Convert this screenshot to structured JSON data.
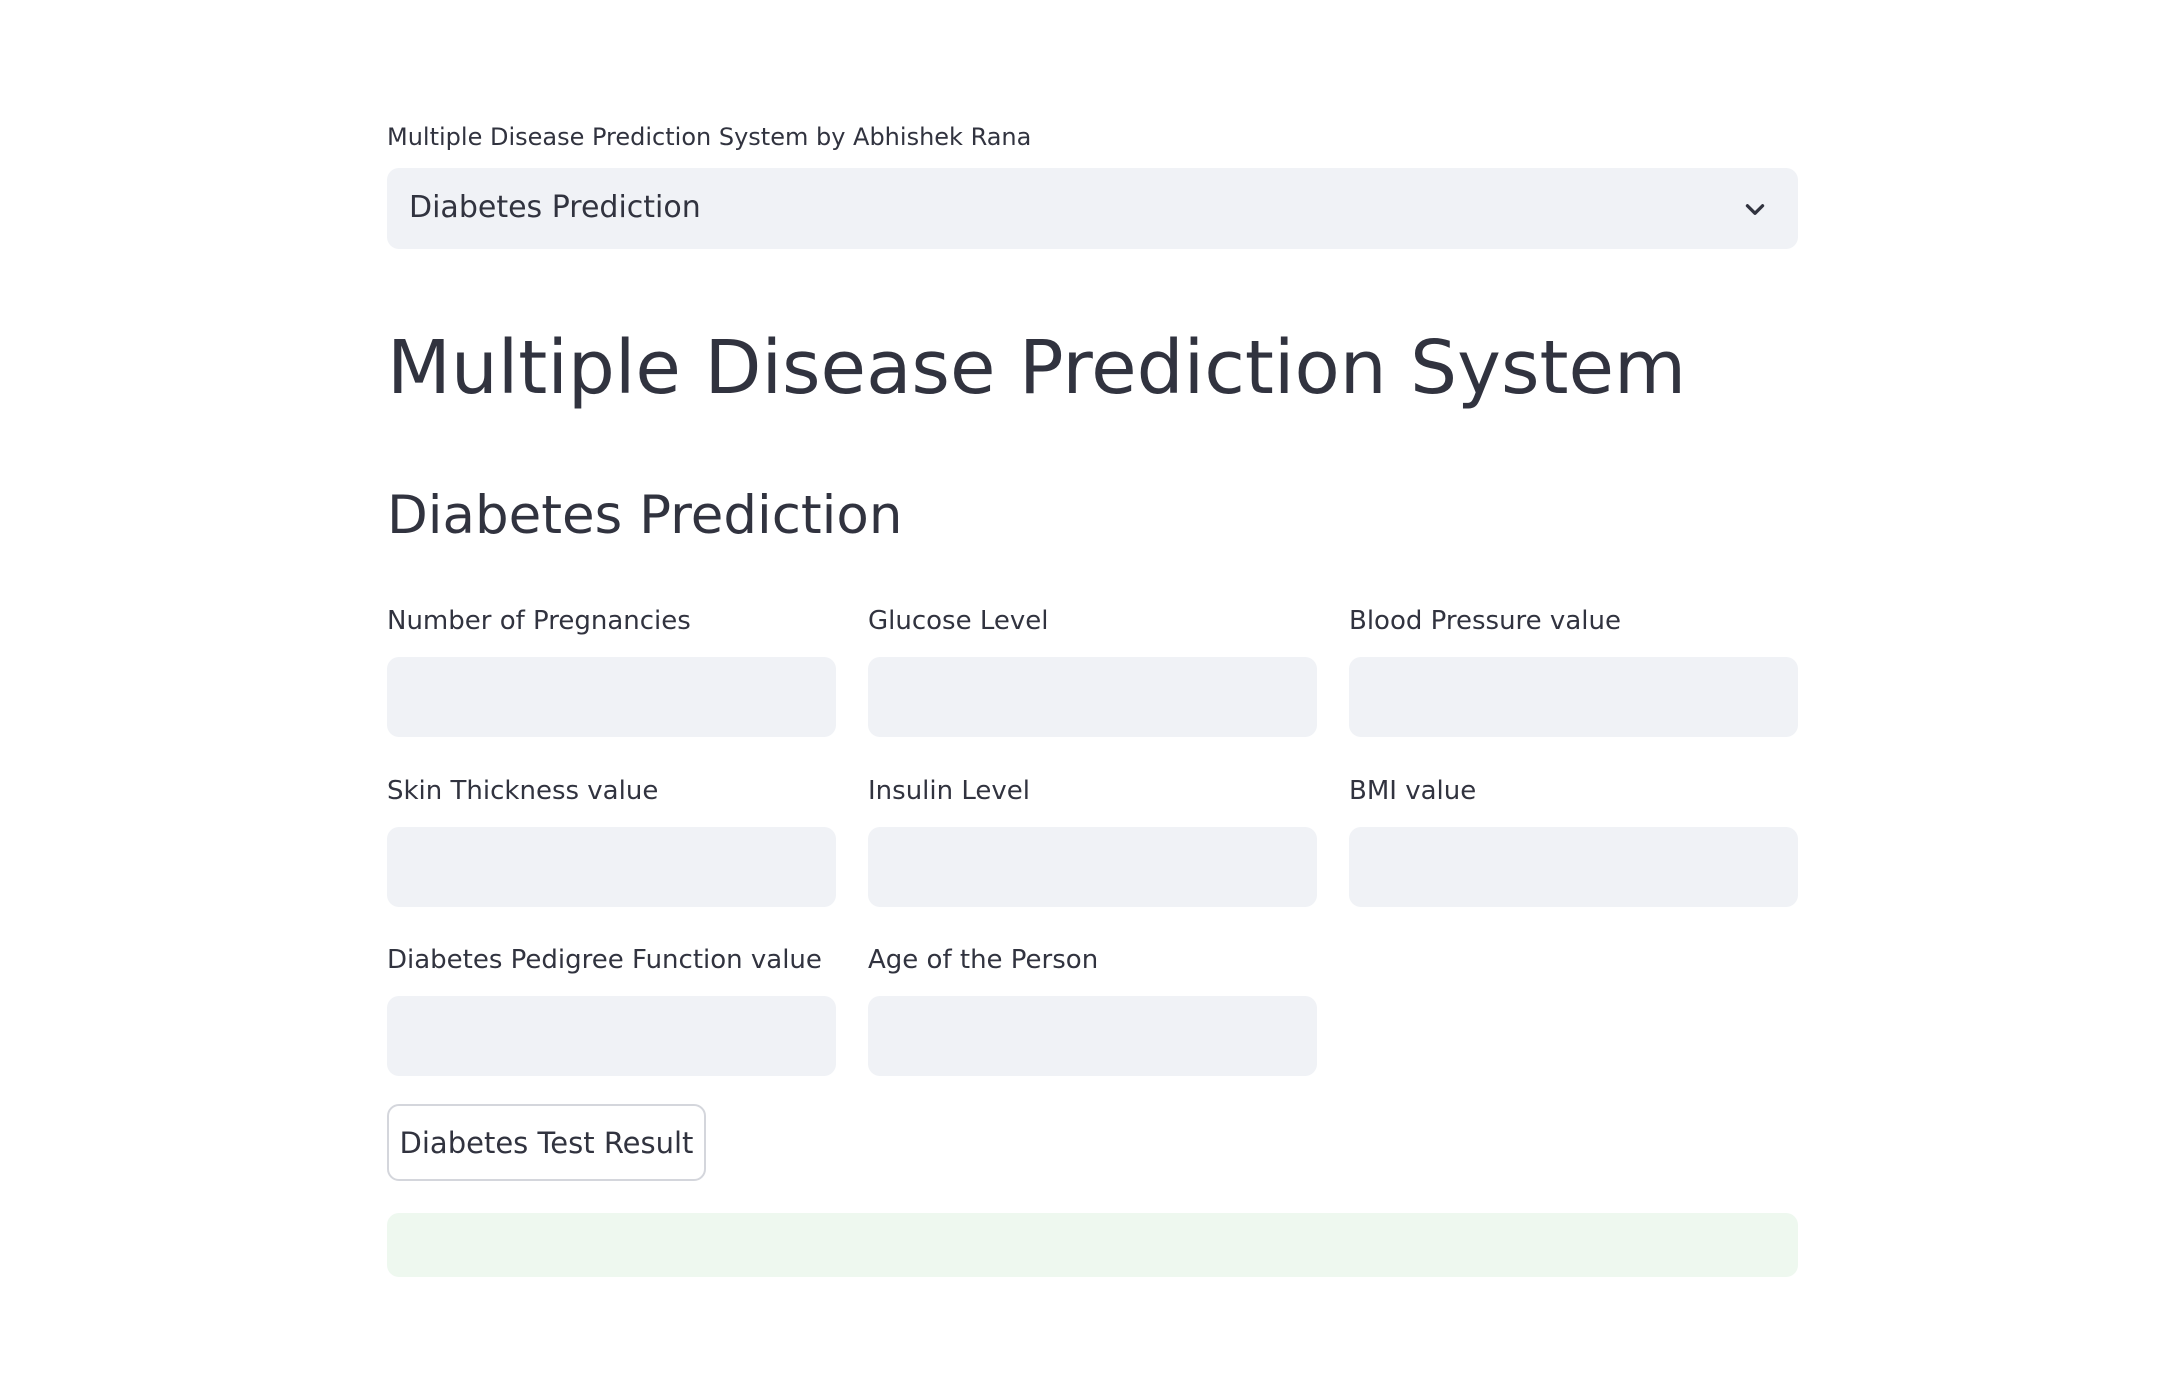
{
  "app": {
    "select_label": "Multiple Disease Prediction System by Abhishek Rana",
    "selected_option": "Diabetes Prediction",
    "title": "Multiple Disease Prediction System",
    "subtitle": "Diabetes Prediction"
  },
  "fields": {
    "pregnancies": {
      "label": "Number of Pregnancies",
      "value": ""
    },
    "glucose": {
      "label": "Glucose Level",
      "value": ""
    },
    "blood_pressure": {
      "label": "Blood Pressure value",
      "value": ""
    },
    "skin_thickness": {
      "label": "Skin Thickness value",
      "value": ""
    },
    "insulin": {
      "label": "Insulin Level",
      "value": ""
    },
    "bmi": {
      "label": "BMI value",
      "value": ""
    },
    "pedigree": {
      "label": "Diabetes Pedigree Function value",
      "value": ""
    },
    "age": {
      "label": "Age of the Person",
      "value": ""
    }
  },
  "actions": {
    "submit_label": "Diabetes Test Result"
  },
  "result": {
    "text": ""
  },
  "icons": {
    "dropdown": "chevron-down-icon"
  },
  "colors": {
    "input_bg": "#f0f2f6",
    "text": "#31333f",
    "success_bg": "#eef8ef"
  }
}
